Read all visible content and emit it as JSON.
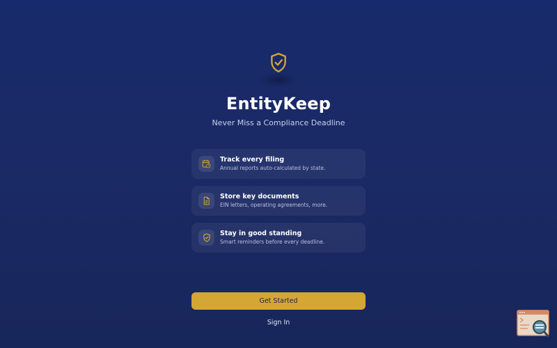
{
  "app": {
    "name": "EntityKeep",
    "tagline": "Never Miss a Compliance Deadline",
    "logo_icon": "shield-check-icon"
  },
  "features": [
    {
      "icon": "calendar-clock-icon",
      "title": "Track every filing",
      "description": "Annual reports auto-calculated by state."
    },
    {
      "icon": "document-icon",
      "title": "Store key documents",
      "description": "EIN letters, operating agreements, more."
    },
    {
      "icon": "shield-check-icon",
      "title": "Stay in good standing",
      "description": "Smart reminders before every deadline."
    }
  ],
  "actions": {
    "primary_label": "Get Started",
    "secondary_label": "Sign In"
  },
  "corner_widget": {
    "icon": "terminal-search-icon"
  },
  "colors": {
    "background": "#1b2a66",
    "accent": "#d4a634",
    "text_primary": "#ffffff",
    "text_secondary": "#c9d1ea"
  }
}
